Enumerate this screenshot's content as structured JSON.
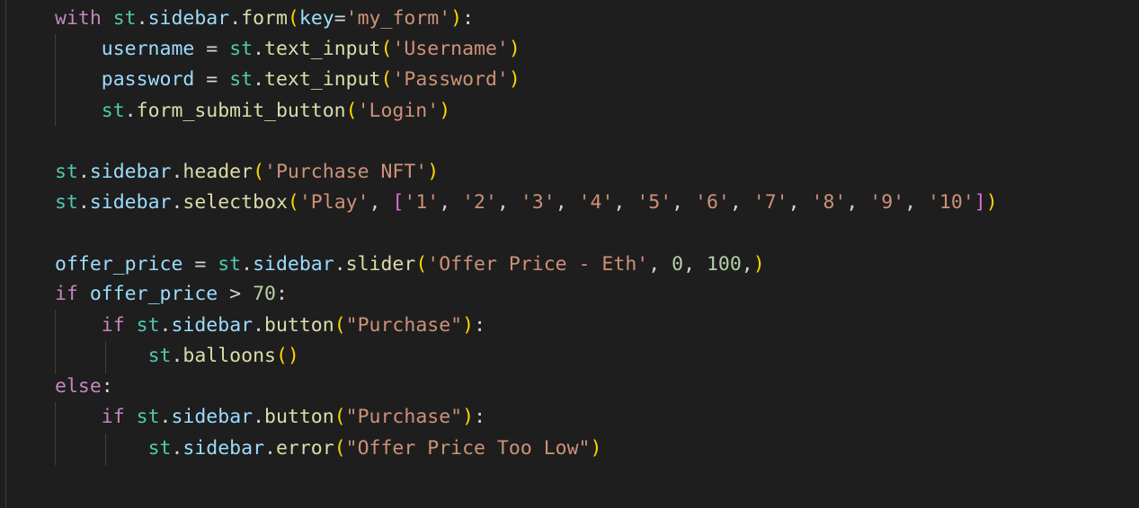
{
  "editor": {
    "theme": {
      "background": "#1e1e1e",
      "keyword": "#c586c0",
      "variable": "#9cdcfe",
      "module": "#4ec9b0",
      "function": "#dcdcaa",
      "string": "#ce9178",
      "number": "#b5cea8",
      "bracket_level1": "#ffd700",
      "bracket_level2": "#da70d6"
    },
    "lines": [
      "with st.sidebar.form(key='my_form'):",
      "    username = st.text_input('Username')",
      "    password = st.text_input('Password')",
      "    st.form_submit_button('Login')",
      "",
      "st.sidebar.header('Purchase NFT')",
      "st.sidebar.selectbox('Play', ['1', '2', '3', '4', '5', '6', '7', '8', '9', '10'])",
      "",
      "offer_price = st.sidebar.slider('Offer Price - Eth', 0, 100,)",
      "if offer_price > 70:",
      "    if st.sidebar.button(\"Purchase\"):",
      "        st.balloons()",
      "else:",
      "    if st.sidebar.button(\"Purchase\"):",
      "        st.sidebar.error(\"Offer Price Too Low\")"
    ]
  }
}
